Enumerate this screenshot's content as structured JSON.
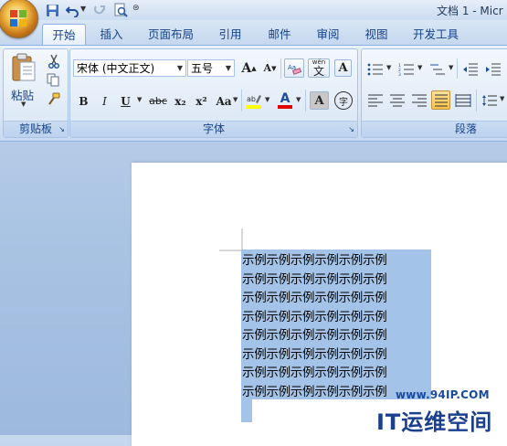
{
  "title_bar": {
    "doc_title": "文档 1 - Micr",
    "quick_access": [
      "save-icon",
      "undo-icon",
      "redo-icon",
      "print-preview-icon"
    ]
  },
  "tabs": [
    {
      "label": "开始",
      "active": true
    },
    {
      "label": "插入"
    },
    {
      "label": "页面布局"
    },
    {
      "label": "引用"
    },
    {
      "label": "邮件"
    },
    {
      "label": "审阅"
    },
    {
      "label": "视图"
    },
    {
      "label": "开发工具"
    }
  ],
  "clipboard": {
    "group_label": "剪贴板",
    "paste_label": "粘贴"
  },
  "font": {
    "group_label": "字体",
    "font_name": "宋体 (中文正文)",
    "font_size": "五号",
    "bold": "B",
    "italic": "I",
    "underline": "U",
    "strikethrough": "abc",
    "subscript": "x₂",
    "superscript": "x²",
    "change_case": "Aa",
    "grow": "A",
    "shrink": "A",
    "phonetic": "wén",
    "phonetic_char": "文",
    "border_char": "A",
    "shade_char": "A",
    "enclose_char": "字",
    "highlight_color": "#ffff00",
    "font_color": "#e00000"
  },
  "paragraph": {
    "group_label": "段落"
  },
  "colors": {
    "accent": "#15428b",
    "selection": "#a3c4e8"
  },
  "document": {
    "lines": [
      "示例示例示例示例示例示例",
      "示例示例示例示例示例示例",
      "示例示例示例示例示例示例",
      "示例示例示例示例示例示例",
      "示例示例示例示例示例示例",
      "示例示例示例示例示例示例",
      "示例示例示例示例示例示例",
      "示例示例示例示例示例示例"
    ]
  },
  "watermark": {
    "url": "www.94IP.COM",
    "brand": "IT运维空间"
  }
}
